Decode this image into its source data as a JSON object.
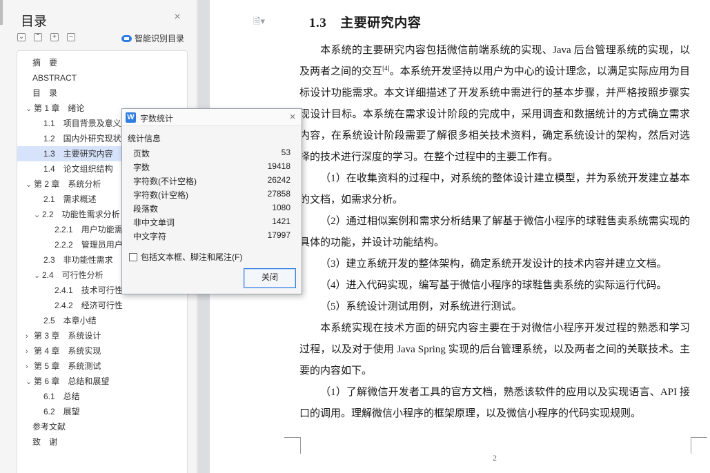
{
  "toc": {
    "title": "目录",
    "smart_label": "智能识别目录",
    "items": [
      {
        "label": "摘　要",
        "chevron": ""
      },
      {
        "label": "ABSTRACT",
        "chevron": ""
      },
      {
        "label": "目　录",
        "chevron": ""
      },
      {
        "label": "第 1 章　绪论",
        "chevron": "﹀"
      },
      {
        "label": "1.1　项目背景及意义",
        "chevron": ""
      },
      {
        "label": "1.2　国内外研究现状",
        "chevron": ""
      },
      {
        "label": "1.3　主要研究内容",
        "chevron": "",
        "active": true
      },
      {
        "label": "1.4　论文组织结构",
        "chevron": ""
      },
      {
        "label": "第 2 章　系统分析",
        "chevron": "﹀"
      },
      {
        "label": "2.1　需求概述",
        "chevron": ""
      },
      {
        "label": "2.2　功能性需求分析",
        "chevron": "﹀"
      },
      {
        "label": "2.2.1　用户功能需",
        "chevron": ""
      },
      {
        "label": "2.2.2　管理员用户",
        "chevron": ""
      },
      {
        "label": "2.3　非功能性需求",
        "chevron": ""
      },
      {
        "label": "2.4　可行性分析",
        "chevron": "﹀"
      },
      {
        "label": "2.4.1　技术可行性",
        "chevron": ""
      },
      {
        "label": "2.4.2　经济可行性",
        "chevron": ""
      },
      {
        "label": "2.5　本章小结",
        "chevron": ""
      },
      {
        "label": "第 3 章　系统设计",
        "chevron": "›"
      },
      {
        "label": "第 4 章　系统实现",
        "chevron": "›"
      },
      {
        "label": "第 5 章　系统测试",
        "chevron": "›"
      },
      {
        "label": "第 6 章　总结和展望",
        "chevron": "﹀"
      },
      {
        "label": "6.1　总结",
        "chevron": ""
      },
      {
        "label": "6.2　展望",
        "chevron": ""
      },
      {
        "label": "参考文献",
        "chevron": ""
      },
      {
        "label": "致　谢",
        "chevron": ""
      }
    ]
  },
  "document": {
    "heading_num": "1.3",
    "heading_text": "主要研究内容",
    "paragraphs": [
      {
        "before": "本系统的主要研究内容包括微信前端系统的实现、Java 后台管理系统的实现，以及两者之间的交互",
        "sup": "[4]",
        "after": "。本系统开发坚持以用户为中心的设计理念，以满足实际应用为目标设计功能需求。本文详细描述了开发系统中需进行的基本步骤，并严格按照步骤实现设计目标。本系统在需求设计阶段的完成中，采用调查和数据统计的方式确立需求内容，在系统设计阶段需要了解很多相关技术资料，确定系统设计的架构，然后对选择的技术进行深度的学习。在整个过程中的主要工作有。"
      },
      {
        "before": "（1）在收集资料的过程中，对系统的整体设计建立模型，并为系统开发建立基本的文档，如需求分析。",
        "sup": "",
        "after": ""
      },
      {
        "before": "（2）通过相似案例和需求分析结果了解基于微信小程序的球鞋售卖系统需实现的具体的功能，并设计功能结构。",
        "sup": "",
        "after": ""
      },
      {
        "before": "（3）建立系统开发的整体架构，确定系统开发设计的技术内容并建立文档。",
        "sup": "",
        "after": ""
      },
      {
        "before": "（4）进入代码实现，编写基于微信小程序的球鞋售卖系统的实际运行代码。",
        "sup": "",
        "after": ""
      },
      {
        "before": "（5）系统设计测试用例，对系统进行测试。",
        "sup": "",
        "after": ""
      },
      {
        "before": "本系统实现在技术方面的研究内容主要在于对微信小程序开发过程的熟悉和学习过程，以及对于使用 Java Spring 实现的后台管理系统，以及两者之间的关联技术。主要的内容如下。",
        "sup": "",
        "after": ""
      },
      {
        "before": "（1）了解微信开发者工具的官方文档，熟悉该软件的应用以及实现语言、API 接口的调用。理解微信小程序的框架原理，以及微信小程序的代码实现规则。",
        "sup": "",
        "after": ""
      }
    ],
    "page_number": "2"
  },
  "word_count": {
    "title": "字数统计",
    "section_label": "统计信息",
    "rows": [
      {
        "label": "页数",
        "value": "53"
      },
      {
        "label": "字数",
        "value": "19418"
      },
      {
        "label": "字符数(不计空格)",
        "value": "26242"
      },
      {
        "label": "字符数(计空格)",
        "value": "27858"
      },
      {
        "label": "段落数",
        "value": "1080"
      },
      {
        "label": "非中文单词",
        "value": "1421"
      },
      {
        "label": "中文字符",
        "value": "17997"
      }
    ],
    "checkbox_label": "包括文本框、脚注和尾注(F)",
    "checkbox_checked": false,
    "close_button": "关闭"
  },
  "colors": {
    "accent": "#2f7de1",
    "toc_active": "#d6e3fa"
  }
}
